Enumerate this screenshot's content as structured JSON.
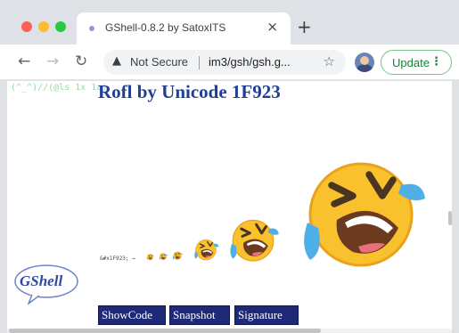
{
  "browser": {
    "tab_title": "GShell-0.8.2 by SatoxITS",
    "tab_close": "×",
    "new_tab": "+",
    "security_label": "Not Secure",
    "url": "im3/gsh/gsh.g...",
    "update_label": "Update"
  },
  "page": {
    "ascii_banner": "(^_^)//(@ls 1x 1a)",
    "heading": "Rofl by Unicode 1F923",
    "emoji_caption": "&#x1F923; →",
    "logo_text": "GShell",
    "buttons": {
      "showcode": "ShowCode",
      "snapshot": "Snapshot",
      "signature": "Signature"
    }
  },
  "emojis": [
    {
      "name": "rofl-emoji-1"
    },
    {
      "name": "rofl-emoji-2"
    },
    {
      "name": "rofl-emoji-3"
    },
    {
      "name": "rofl-emoji-4"
    },
    {
      "name": "rofl-emoji-5"
    },
    {
      "name": "rofl-emoji-6"
    }
  ]
}
